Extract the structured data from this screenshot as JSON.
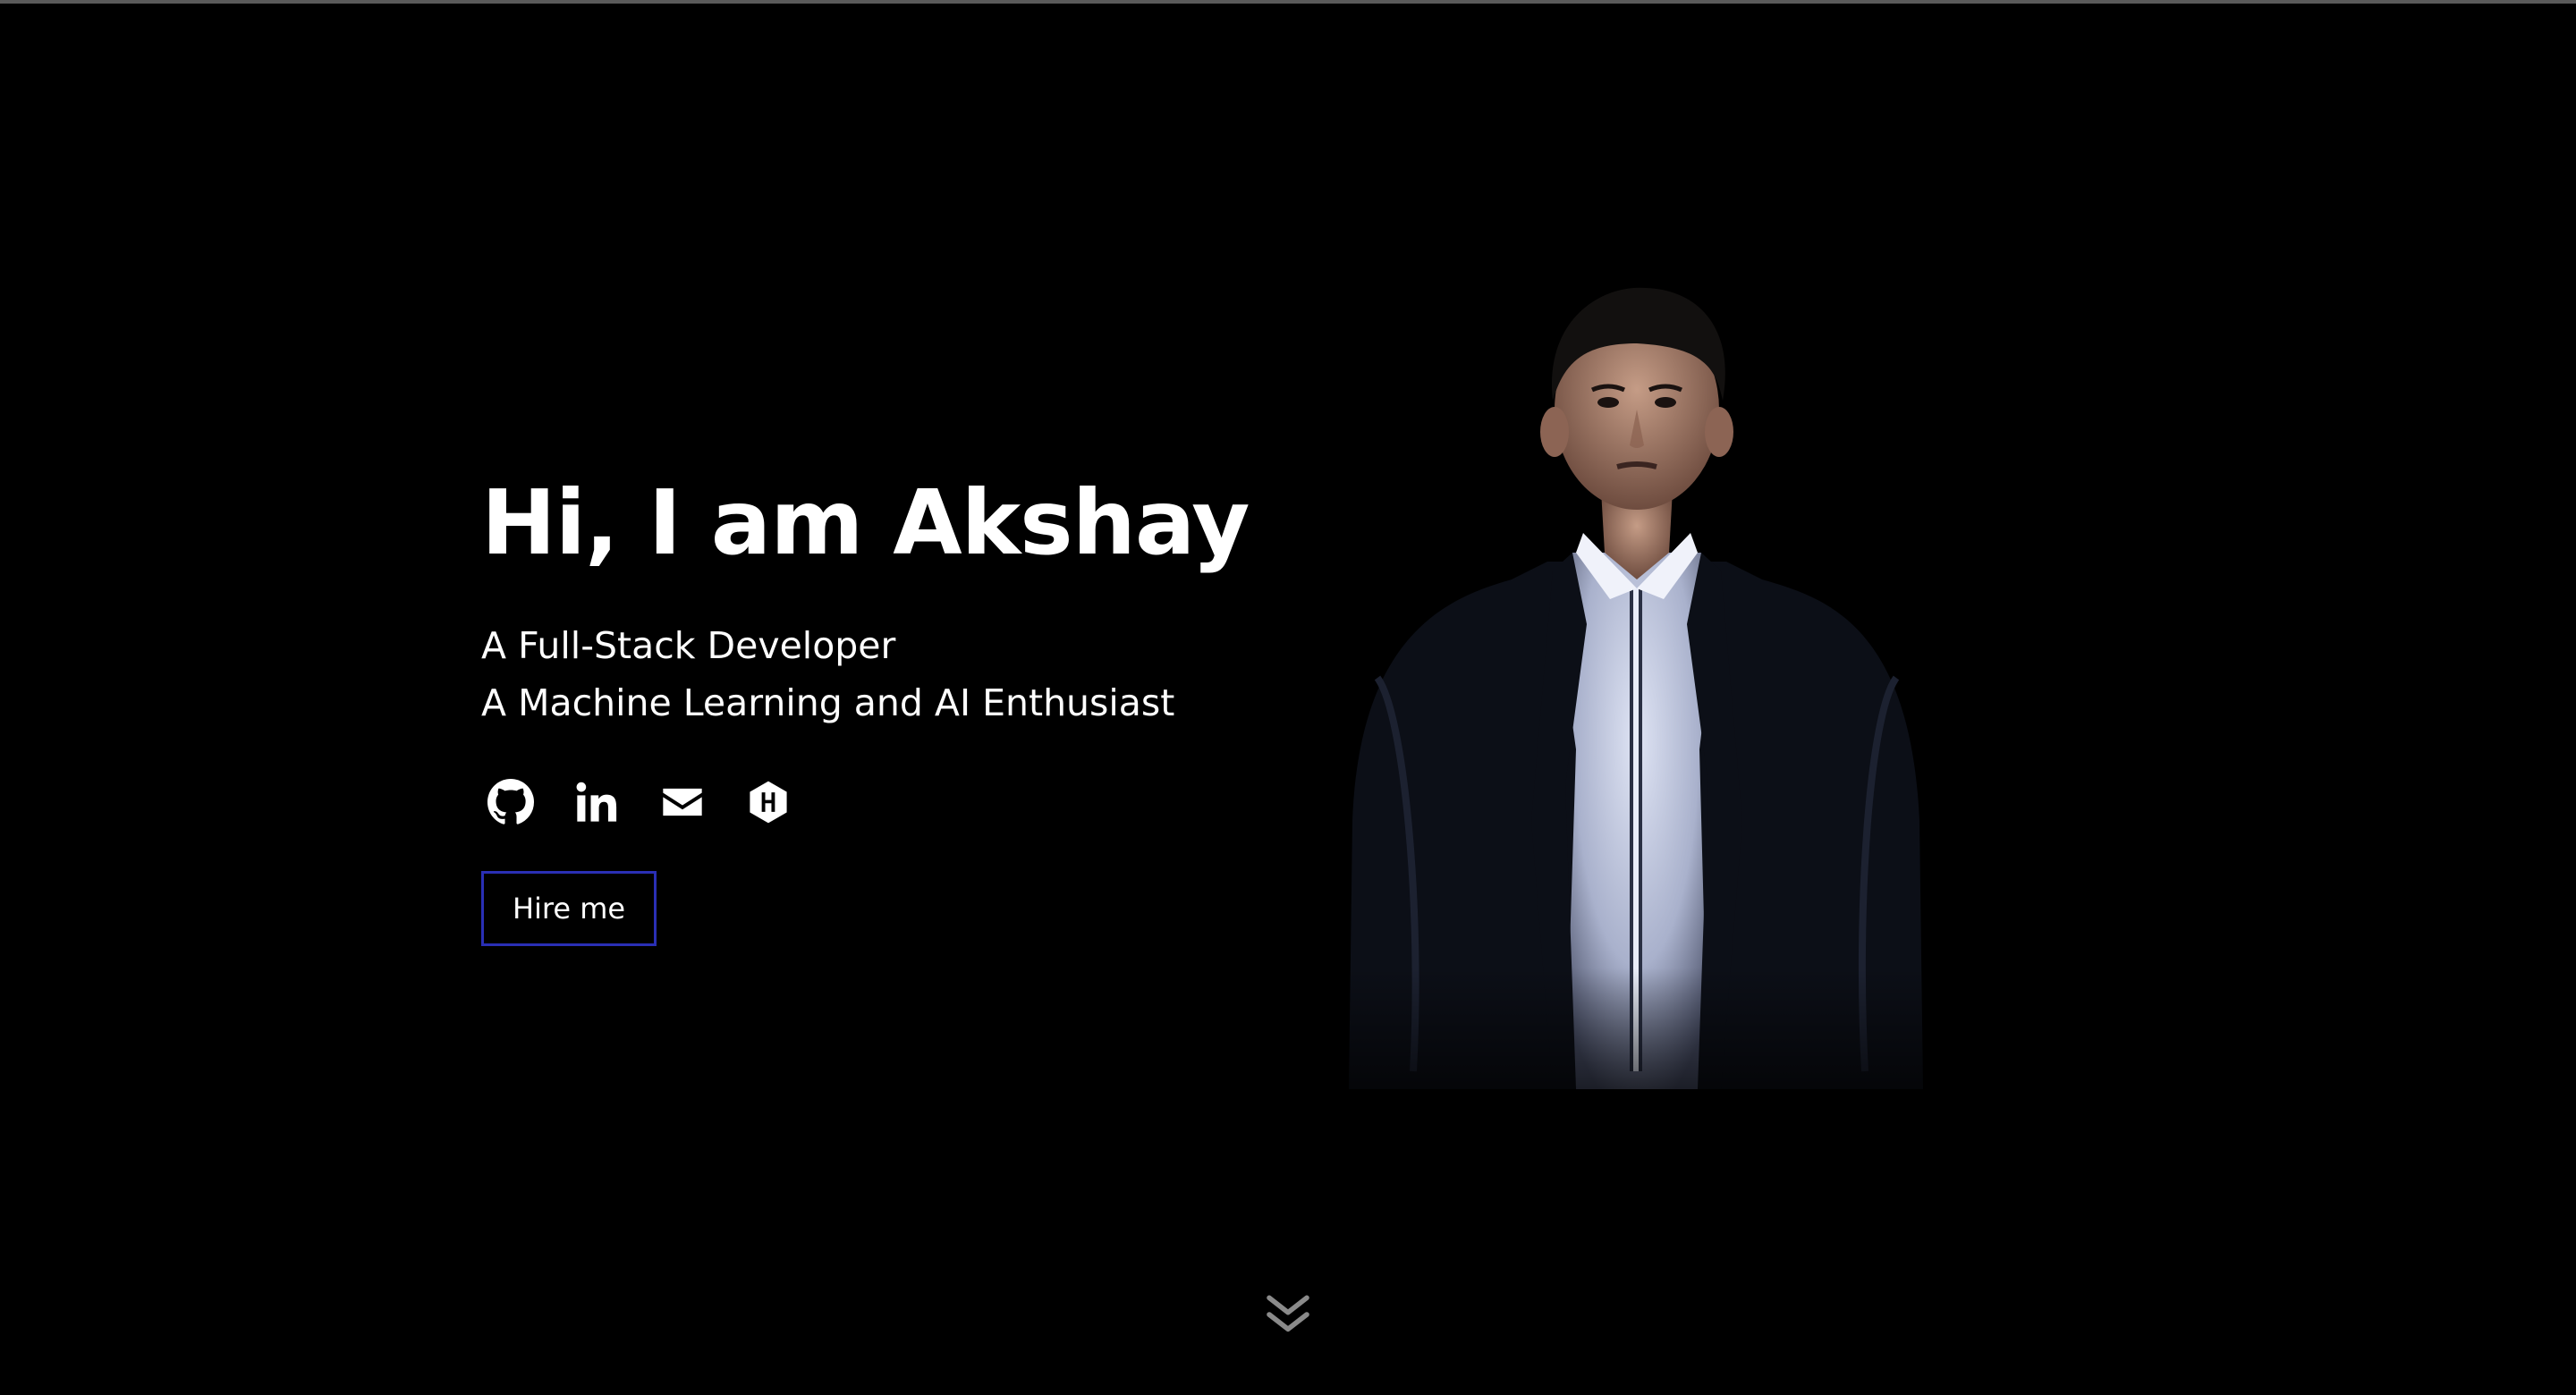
{
  "hero": {
    "headline": "Hi, I am Akshay",
    "taglines": [
      "A Full-Stack Developer",
      "A Machine Learning and AI Enthusiast"
    ],
    "social_links": [
      {
        "icon": "github-icon"
      },
      {
        "icon": "linkedin-icon"
      },
      {
        "icon": "email-icon"
      },
      {
        "icon": "hackerrank-icon"
      }
    ],
    "cta_label": "Hire me"
  },
  "scroll_hint": {
    "icon": "double-chevron-down-icon"
  },
  "colors": {
    "background": "#000000",
    "text": "#ffffff",
    "button_border": "#2a2fb5",
    "scroll_icon": "#8a8a8a"
  }
}
